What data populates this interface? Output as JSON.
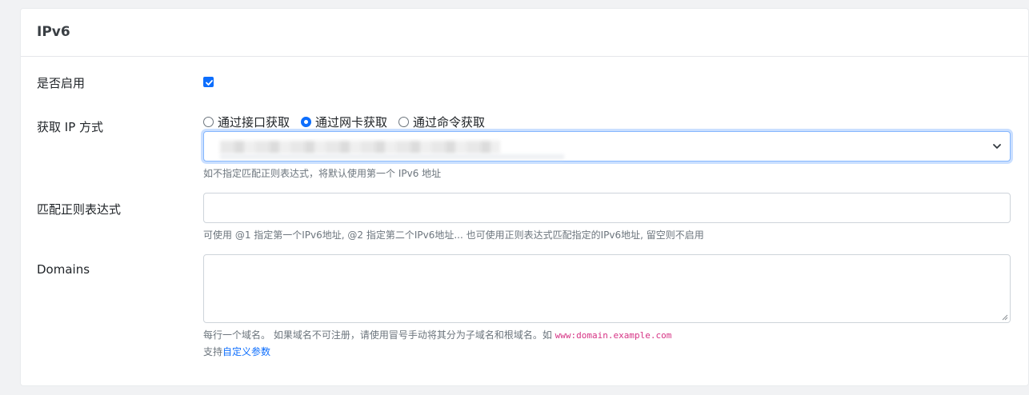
{
  "card": {
    "title": "IPv6"
  },
  "enable": {
    "label": "是否启用",
    "checked": true
  },
  "get_ip": {
    "label": "获取 IP 方式",
    "options": [
      "通过接口获取",
      "通过网卡获取",
      "通过命令获取"
    ],
    "selected_index": 1,
    "help": "如不指定匹配正则表达式，将默认使用第一个 IPv6 地址"
  },
  "regex": {
    "label": "匹配正则表达式",
    "value": "",
    "help": "可使用 @1 指定第一个IPv6地址, @2 指定第二个IPv6地址... 也可使用正则表达式匹配指定的IPv6地址, 留空则不启用"
  },
  "domains": {
    "label": "Domains",
    "value": "",
    "help_prefix": "每行一个域名。 如果域名不可注册，请使用冒号手动将其分为子域名和根域名。如 ",
    "help_example": "www:domain.example.com",
    "support_prefix": "支持",
    "support_link": "自定义参数"
  },
  "colors": {
    "accent": "#0d6efd",
    "code": "#d63384",
    "muted": "#6c757d"
  }
}
